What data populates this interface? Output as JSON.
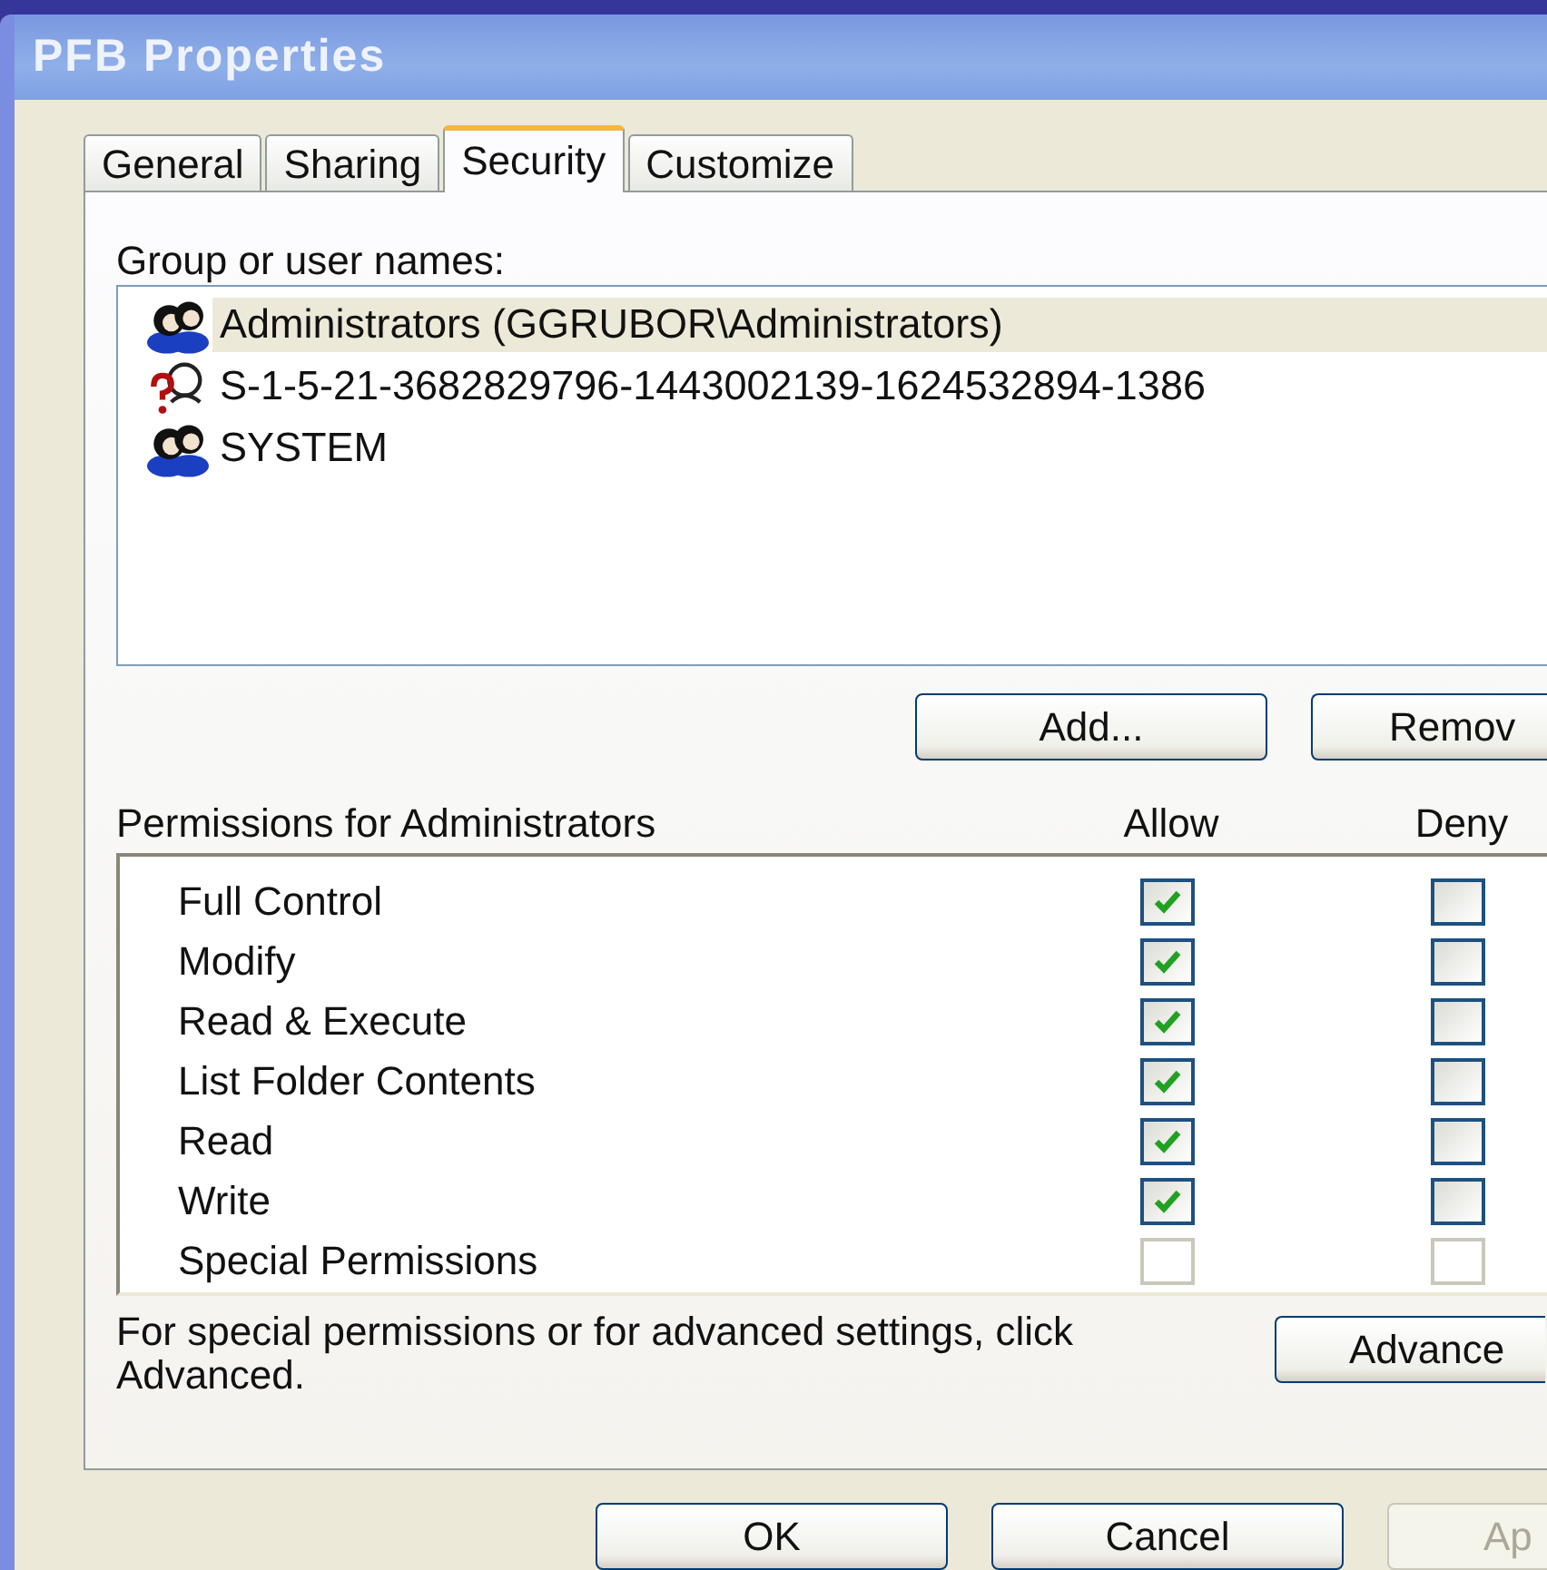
{
  "window": {
    "title": "PFB Properties"
  },
  "tabs": [
    {
      "label": "General",
      "selected": false
    },
    {
      "label": "Sharing",
      "selected": false
    },
    {
      "label": "Security",
      "selected": true
    },
    {
      "label": "Customize",
      "selected": false
    }
  ],
  "users": {
    "label": "Group or user names:",
    "items": [
      {
        "name": "Administrators (GGRUBOR\\Administrators)",
        "kind": "group",
        "selected": true
      },
      {
        "name": "S-1-5-21-3682829796-1443002139-1624532894-1386",
        "kind": "unknown",
        "selected": false
      },
      {
        "name": "SYSTEM",
        "kind": "group",
        "selected": false
      }
    ]
  },
  "user_buttons": [
    {
      "label": "Add...",
      "disabled": false
    },
    {
      "label": "Remov",
      "disabled": false
    }
  ],
  "permissions": {
    "label": "Permissions for Administrators",
    "allow_heading": "Allow",
    "deny_heading": "Deny",
    "rows": [
      {
        "name": "Full Control",
        "allow": true,
        "deny": false,
        "disabled": false
      },
      {
        "name": "Modify",
        "allow": true,
        "deny": false,
        "disabled": false
      },
      {
        "name": "Read & Execute",
        "allow": true,
        "deny": false,
        "disabled": false
      },
      {
        "name": "List Folder Contents",
        "allow": true,
        "deny": false,
        "disabled": false
      },
      {
        "name": "Read",
        "allow": true,
        "deny": false,
        "disabled": false
      },
      {
        "name": "Write",
        "allow": true,
        "deny": false,
        "disabled": false
      },
      {
        "name": "Special Permissions",
        "allow": false,
        "deny": false,
        "disabled": true
      }
    ]
  },
  "advanced": {
    "note": "For special permissions or for advanced settings, click Advanced.",
    "button": "Advance"
  },
  "buttons": [
    {
      "label": "OK",
      "disabled": false
    },
    {
      "label": "Cancel",
      "disabled": false
    },
    {
      "label": "Ap",
      "disabled": true
    }
  ]
}
